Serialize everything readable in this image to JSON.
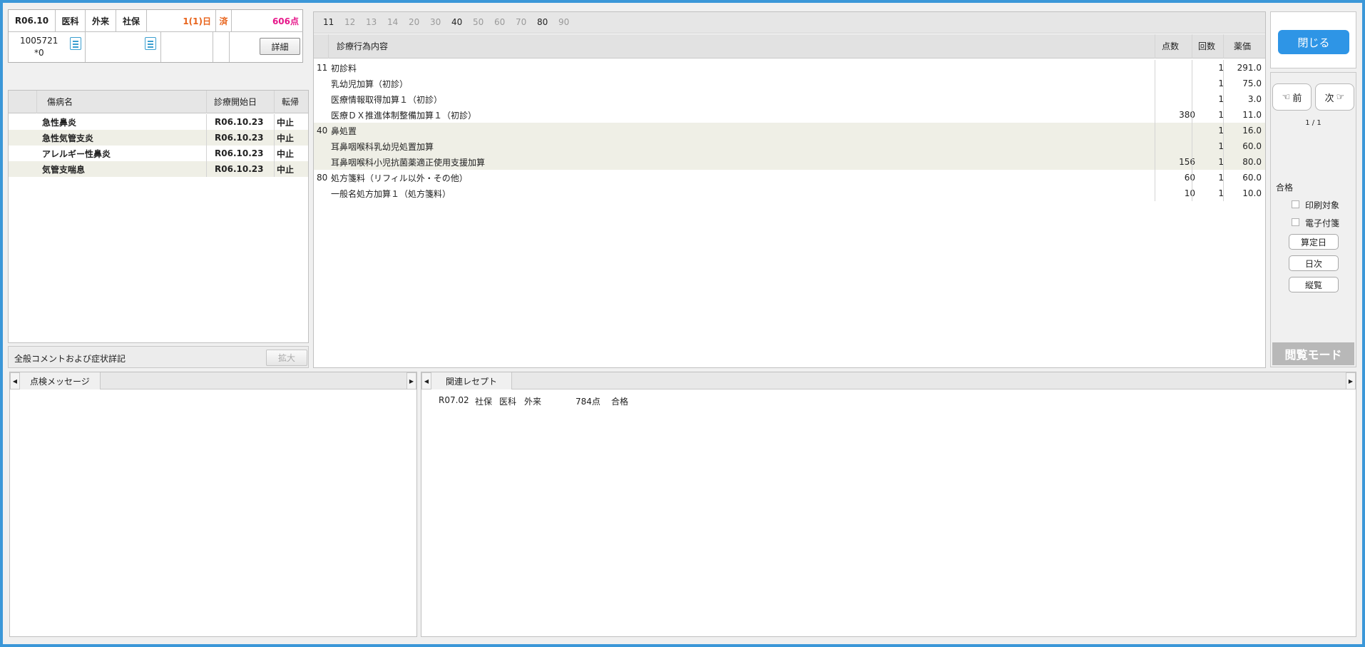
{
  "header": {
    "date": "R06.10",
    "dept": "医科",
    "type": "外来",
    "insurance": "社保",
    "days": "1(1)日",
    "status": "済",
    "points": "606点",
    "patient_id": "1005721",
    "patient_sub": "*0",
    "detail_button": "詳細"
  },
  "diseases": {
    "headers": [
      "傷病名",
      "診療開始日",
      "転帰"
    ],
    "rows": [
      {
        "name": "急性鼻炎",
        "date": "R06.10.23",
        "outcome": "中止"
      },
      {
        "name": "急性気管支炎",
        "date": "R06.10.23",
        "outcome": "中止"
      },
      {
        "name": "アレルギー性鼻炎",
        "date": "R06.10.23",
        "outcome": "中止"
      },
      {
        "name": "気管支喘息",
        "date": "R06.10.23",
        "outcome": "中止"
      }
    ]
  },
  "comment": {
    "label": "全般コメントおよび症状詳記",
    "expand_button": "拡大"
  },
  "treatment": {
    "tabs": [
      {
        "label": "11",
        "active": true
      },
      {
        "label": "12",
        "active": false
      },
      {
        "label": "13",
        "active": false
      },
      {
        "label": "14",
        "active": false
      },
      {
        "label": "20",
        "active": false
      },
      {
        "label": "30",
        "active": false
      },
      {
        "label": "40",
        "active": true
      },
      {
        "label": "50",
        "active": false
      },
      {
        "label": "60",
        "active": false
      },
      {
        "label": "70",
        "active": false
      },
      {
        "label": "80",
        "active": true
      },
      {
        "label": "90",
        "active": false
      }
    ],
    "headers": {
      "content": "診療行為内容",
      "points": "点数",
      "count": "回数",
      "price": "薬価"
    },
    "rows": [
      {
        "code": "11",
        "name": "初診料",
        "points": "",
        "count": "1",
        "price": "291.0"
      },
      {
        "code": "",
        "name": "乳幼児加算（初診）",
        "points": "",
        "count": "1",
        "price": "75.0"
      },
      {
        "code": "",
        "name": "医療情報取得加算１（初診）",
        "points": "",
        "count": "1",
        "price": "3.0"
      },
      {
        "code": "",
        "name": "医療ＤＸ推進体制整備加算１（初診）",
        "points": "380",
        "count": "1",
        "price": "11.0"
      },
      {
        "code": "40",
        "name": "鼻処置",
        "points": "",
        "count": "1",
        "price": "16.0"
      },
      {
        "code": "",
        "name": "耳鼻咽喉科乳幼児処置加算",
        "points": "",
        "count": "1",
        "price": "60.0"
      },
      {
        "code": "",
        "name": "耳鼻咽喉科小児抗菌薬適正使用支援加算",
        "points": "156",
        "count": "1",
        "price": "80.0"
      },
      {
        "code": "80",
        "name": "処方箋料（リフィル以外・その他）",
        "points": "60",
        "count": "1",
        "price": "60.0"
      },
      {
        "code": "",
        "name": "一般名処方加算１（処方箋料）",
        "points": "10",
        "count": "1",
        "price": "10.0"
      }
    ]
  },
  "side": {
    "close_button": "閉じる",
    "prev_button": "前",
    "next_button": "次",
    "page": "1 / 1",
    "result": "合格",
    "print_target": "印刷対象",
    "e_tag": "電子付箋",
    "calc_date_button": "算定日",
    "daily_button": "日次",
    "vertical_button": "縦覧",
    "view_mode": "閲覧モード"
  },
  "check_messages": {
    "tab": "点検メッセージ"
  },
  "related": {
    "tab": "関連レセプト",
    "rows": [
      {
        "date": "R07.02",
        "insurance": "社保",
        "dept": "医科",
        "type": "外来",
        "points": "784点",
        "result": "合格"
      }
    ]
  },
  "colors": {
    "accent": "#2e95e6",
    "frame": "#3b97d8",
    "days": "#e8641c",
    "points": "#e6178a",
    "icon": "#3b9fd0"
  }
}
